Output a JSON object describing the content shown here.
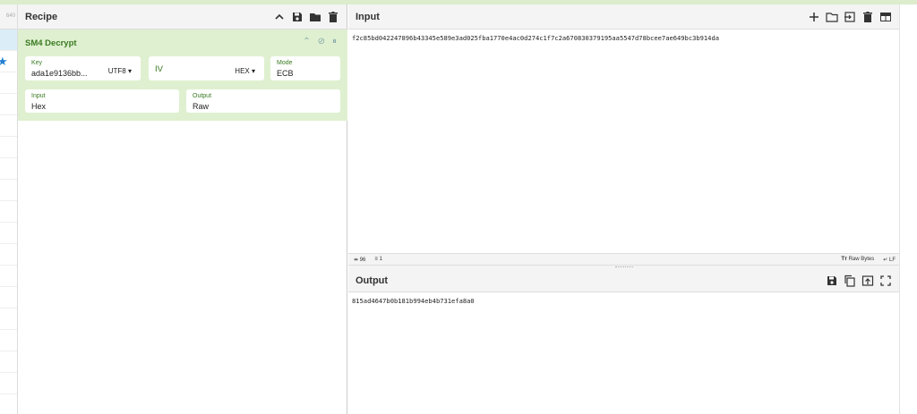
{
  "ops_panel": {
    "header_num": "640"
  },
  "recipe": {
    "title": "Recipe",
    "operation": {
      "name": "SM4 Decrypt",
      "key": {
        "label": "Key",
        "value": "ada1e9136bb...",
        "encoding": "UTF8"
      },
      "iv": {
        "label": "IV",
        "value": "",
        "encoding": "HEX"
      },
      "mode": {
        "label": "Mode",
        "value": "ECB"
      },
      "input_fmt": {
        "label": "Input",
        "value": "Hex"
      },
      "output_fmt": {
        "label": "Output",
        "value": "Raw"
      }
    }
  },
  "input": {
    "title": "Input",
    "text": "f2c85bd042247896b43345e589e3ad025fba1770e4ac0d274c1f7c2a670830379195aa5547d78bcee7ae649bc3b914da",
    "status": {
      "length": "96",
      "lines": "1",
      "raw_bytes": "Raw Bytes",
      "eol": "LF"
    }
  },
  "output": {
    "title": "Output",
    "text": "815ad4647b0b181b994eb4b731efa8a0"
  },
  "colors": {
    "accent_green": "#3a7a22",
    "op_bg": "#dff0d0",
    "header_bg": "#f4f4f4",
    "star": "#1f7fd1"
  }
}
